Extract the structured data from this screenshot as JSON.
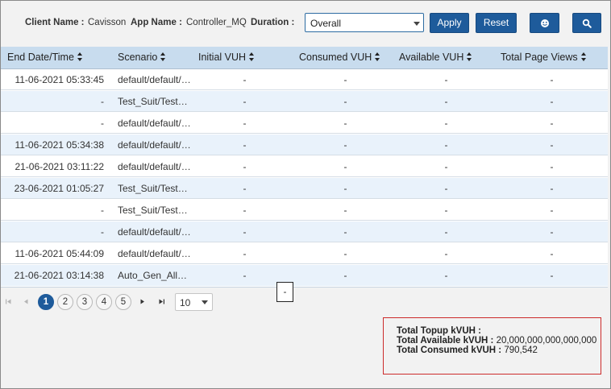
{
  "filters": {
    "client_label": "Client Name :",
    "client_value": "Cavisson",
    "app_label": "App Name :",
    "app_value": "Controller_MQ",
    "duration_label": "Duration :",
    "duration_value": "Overall",
    "apply_label": "Apply",
    "reset_label": "Reset",
    "extra_icon": "smiley-icon",
    "search_icon": "search-icon"
  },
  "table": {
    "columns": [
      "End Date/Time",
      "Scenario",
      "Initial VUH",
      "Consumed VUH",
      "Available VUH",
      "Total Page Views"
    ],
    "rows": [
      [
        "11-06-2021 05:33:45",
        "default/default/…",
        "-",
        "-",
        "-",
        "-"
      ],
      [
        "-",
        "Test_Suit/Test…",
        "-",
        "-",
        "-",
        "-"
      ],
      [
        "-",
        "default/default/…",
        "-",
        "-",
        "-",
        "-"
      ],
      [
        "11-06-2021 05:34:38",
        "default/default/…",
        "-",
        "-",
        "-",
        "-"
      ],
      [
        "21-06-2021 03:11:22",
        "default/default/…",
        "-",
        "-",
        "-",
        "-"
      ],
      [
        "23-06-2021 01:05:27",
        "Test_Suit/Test…",
        "-",
        "-",
        "-",
        "-"
      ],
      [
        "-",
        "Test_Suit/Test…",
        "-",
        "-",
        "-",
        "-"
      ],
      [
        "-",
        "default/default/…",
        "-",
        "-",
        "-",
        "-"
      ],
      [
        "11-06-2021 05:44:09",
        "default/default/…",
        "-",
        "-",
        "-",
        "-"
      ],
      [
        "21-06-2021 03:14:38",
        "Auto_Gen_All…",
        "-",
        "-",
        "-",
        "-"
      ]
    ]
  },
  "tooltip": "-",
  "pagination": {
    "pages": [
      "1",
      "2",
      "3",
      "4",
      "5"
    ],
    "current": "1",
    "page_size": "10"
  },
  "summary": {
    "topup_label": "Total Topup kVUH :",
    "topup_value": "",
    "available_label": "Total Available kVUH :",
    "available_value": "20,000,000,000,000,000",
    "consumed_label": "Total Consumed kVUH :",
    "consumed_value": "790,542"
  },
  "colors": {
    "accent": "#1e5b9b",
    "header_bg": "#c8dcee",
    "alt_row": "#e9f2fb",
    "summary_border": "#cc2b2b"
  }
}
